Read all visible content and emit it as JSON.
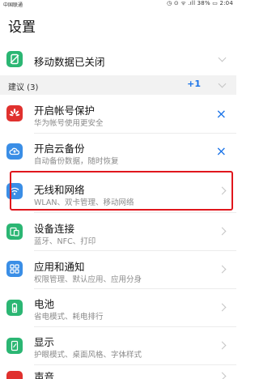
{
  "status_bar": {
    "carrier": "中国联通",
    "right": "◷ ⊙ ᯤ .ıll 38% ▭ 2:04"
  },
  "page": {
    "title": "设置"
  },
  "mobile_data": {
    "label": "移动数据已关闭",
    "icon": "mobile-data-icon"
  },
  "suggestions": {
    "label": "建议 (3)",
    "count": "+1"
  },
  "suggestion_items": [
    {
      "label": "开启帐号保护",
      "sub": "华为帐号使用更安全",
      "icon": "huawei-icon",
      "action": "×"
    },
    {
      "label": "开启云备份",
      "sub": "自动备份数据，随时恢复",
      "icon": "cloud-backup-icon",
      "action": "×"
    }
  ],
  "settings_items": [
    {
      "label": "无线和网络",
      "sub": "WLAN、双卡管理、移动网络",
      "icon": "wifi-icon"
    },
    {
      "label": "设备连接",
      "sub": "蓝牙、NFC、打印",
      "icon": "device-connection-icon"
    },
    {
      "label": "应用和通知",
      "sub": "权限管理、默认应用、应用分身",
      "icon": "apps-icon"
    },
    {
      "label": "电池",
      "sub": "省电模式、耗电排行",
      "icon": "battery-icon"
    },
    {
      "label": "显示",
      "sub": "护眼模式、桌面风格、字体样式",
      "icon": "display-icon"
    },
    {
      "label": "声音",
      "sub": "",
      "icon": "sound-icon"
    }
  ],
  "colors": {
    "accent": "#1a73e8",
    "highlight": "#e0161d",
    "green": "#2bb673",
    "red": "#e0312e",
    "blue": "#3a8ee6"
  }
}
